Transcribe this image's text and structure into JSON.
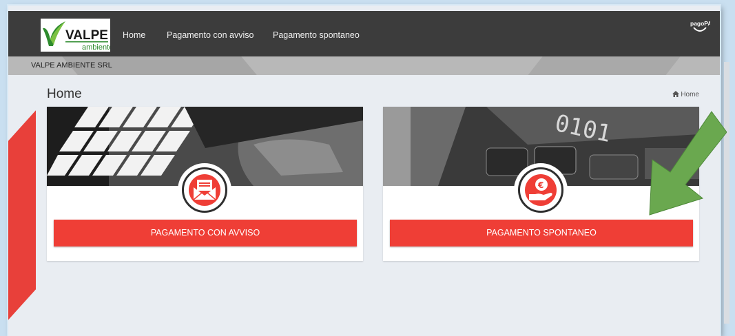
{
  "header": {
    "logo": {
      "text": "VALPE",
      "subtext": "ambiente"
    },
    "nav": [
      "Home",
      "Pagamento con avviso",
      "Pagamento spontaneo"
    ],
    "pagopa_label": "pagoPA"
  },
  "subheader": {
    "company": "VALPE AMBIENTE SRL"
  },
  "page": {
    "title": "Home",
    "breadcrumb": "Home"
  },
  "cards": [
    {
      "icon": "envelope-icon",
      "button": "PAGAMENTO CON AVVISO"
    },
    {
      "icon": "euro-hand-icon",
      "button": "PAGAMENTO SPONTANEO"
    }
  ],
  "colors": {
    "accent": "#ef3e36",
    "topbar": "#3c3c3c",
    "arrow": "#6aa84f"
  }
}
